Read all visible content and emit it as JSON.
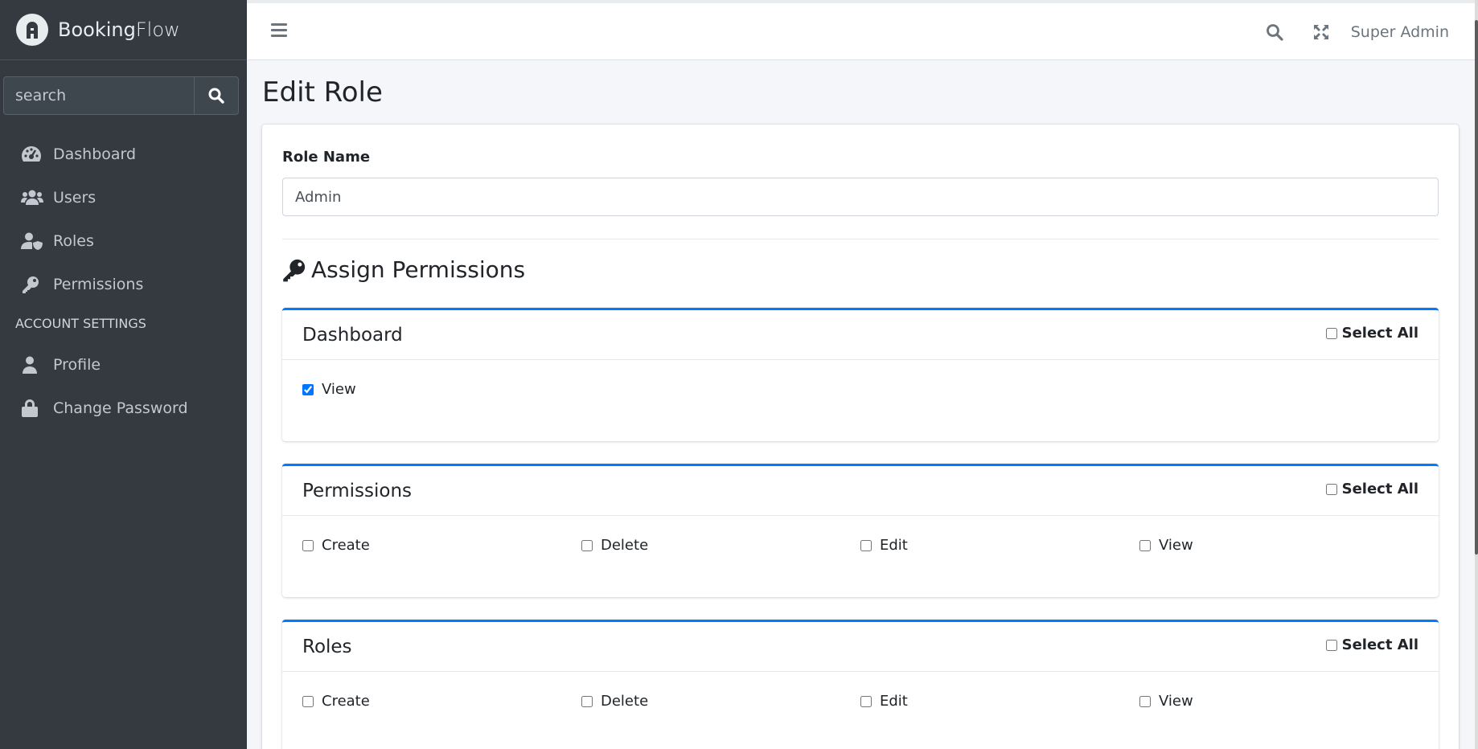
{
  "brand": {
    "name_bold": "Booking",
    "name_rest": "Flow"
  },
  "sidebar": {
    "search_placeholder": "search",
    "items": [
      {
        "label": "Dashboard",
        "icon": "tachometer-icon"
      },
      {
        "label": "Users",
        "icon": "users-icon"
      },
      {
        "label": "Roles",
        "icon": "user-shield-icon"
      },
      {
        "label": "Permissions",
        "icon": "key-icon"
      }
    ],
    "account_header": "ACCOUNT SETTINGS",
    "account_items": [
      {
        "label": "Profile",
        "icon": "user-icon"
      },
      {
        "label": "Change Password",
        "icon": "lock-icon"
      }
    ]
  },
  "navbar": {
    "user": "Super Admin"
  },
  "page": {
    "title": "Edit Role",
    "role_name_label": "Role Name",
    "role_name_value": "Admin",
    "assign_title": "Assign Permissions"
  },
  "permission_groups": [
    {
      "title": "Dashboard",
      "select_all": "Select All",
      "options": [
        {
          "label": "View",
          "checked": true
        }
      ]
    },
    {
      "title": "Permissions",
      "select_all": "Select All",
      "options": [
        {
          "label": "Create",
          "checked": false
        },
        {
          "label": "Delete",
          "checked": false
        },
        {
          "label": "Edit",
          "checked": false
        },
        {
          "label": "View",
          "checked": false
        }
      ]
    },
    {
      "title": "Roles",
      "select_all": "Select All",
      "options": [
        {
          "label": "Create",
          "checked": false
        },
        {
          "label": "Delete",
          "checked": false
        },
        {
          "label": "Edit",
          "checked": false
        },
        {
          "label": "View",
          "checked": false
        }
      ]
    }
  ],
  "colors": {
    "sidebar": "#343a40",
    "accent": "#007bff",
    "checkbox": "#1a73e8"
  }
}
